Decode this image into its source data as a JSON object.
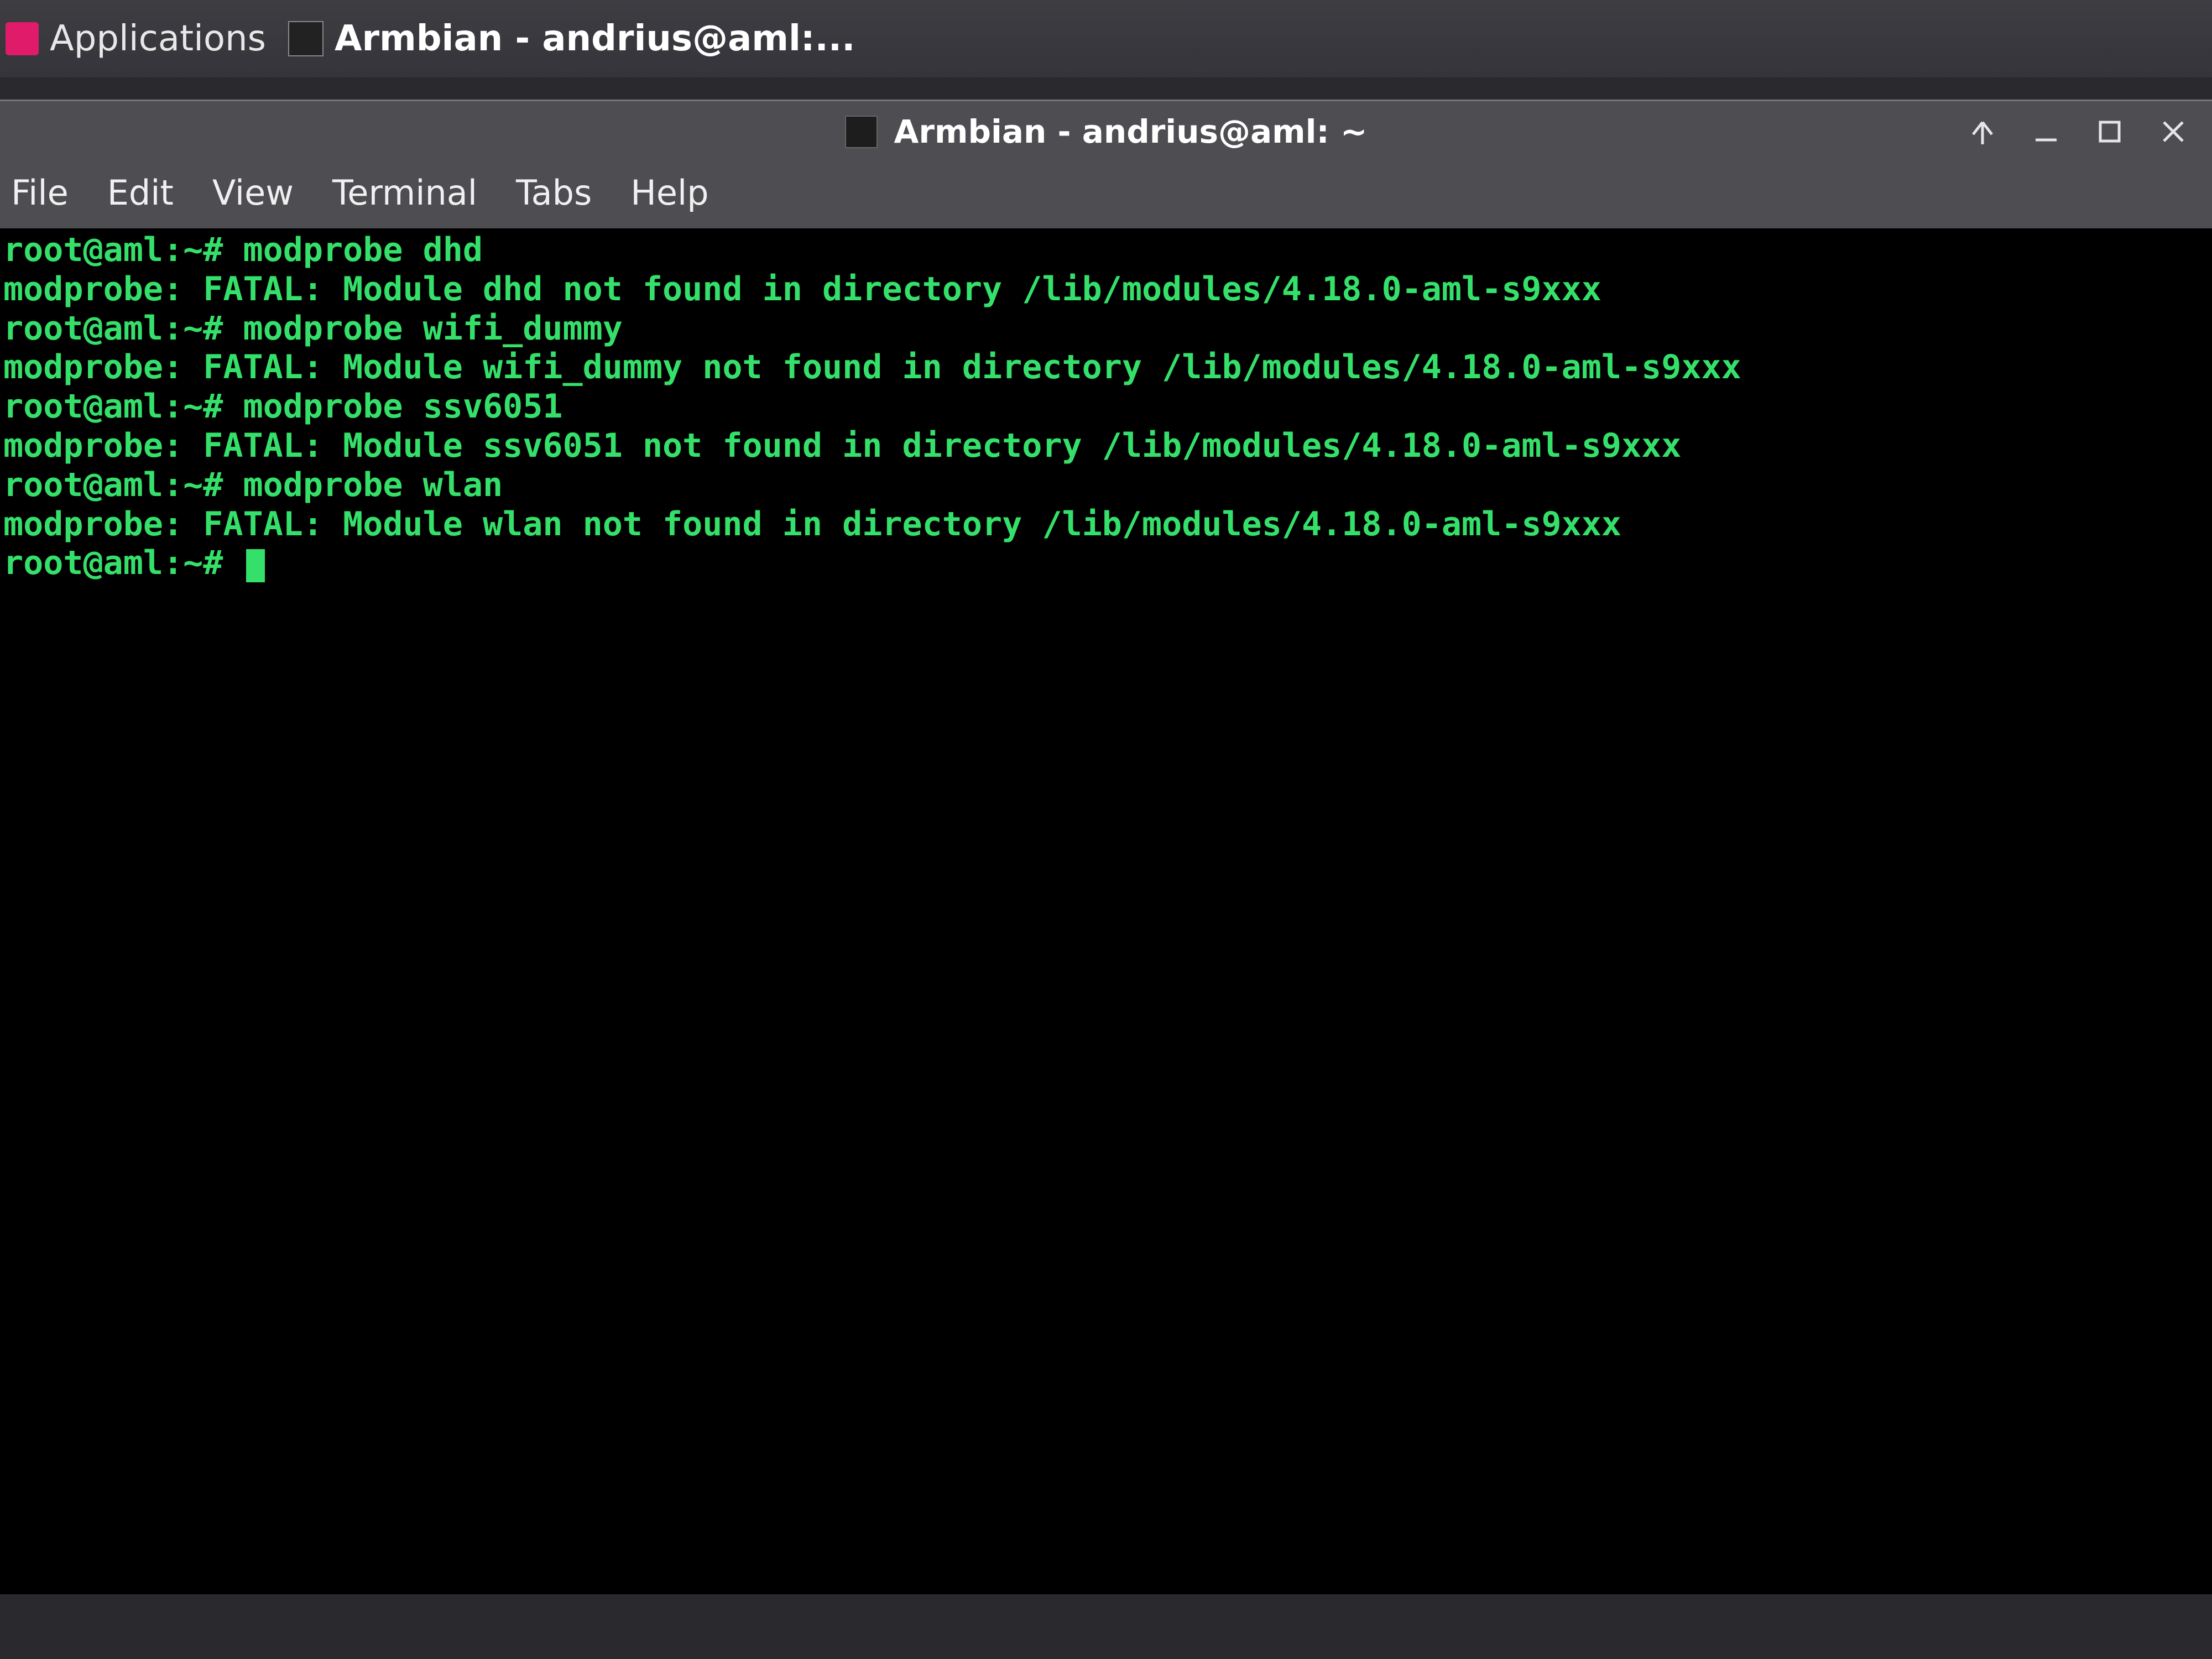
{
  "panel": {
    "applications_label": "Applications",
    "task_label": "Armbian - andrius@aml:..."
  },
  "window": {
    "title": "Armbian - andrius@aml: ~"
  },
  "menubar": {
    "file": "File",
    "edit": "Edit",
    "view": "View",
    "terminal": "Terminal",
    "tabs": "Tabs",
    "help": "Help"
  },
  "terminal": {
    "lines": [
      "root@aml:~# modprobe dhd",
      "modprobe: FATAL: Module dhd not found in directory /lib/modules/4.18.0-aml-s9xxx",
      "root@aml:~# modprobe wifi_dummy",
      "modprobe: FATAL: Module wifi_dummy not found in directory /lib/modules/4.18.0-aml-s9xxx",
      "root@aml:~# modprobe ssv6051",
      "modprobe: FATAL: Module ssv6051 not found in directory /lib/modules/4.18.0-aml-s9xxx",
      "root@aml:~# modprobe wlan",
      "modprobe: FATAL: Module wlan not found in directory /lib/modules/4.18.0-aml-s9xxx"
    ],
    "prompt": "root@aml:~# "
  }
}
